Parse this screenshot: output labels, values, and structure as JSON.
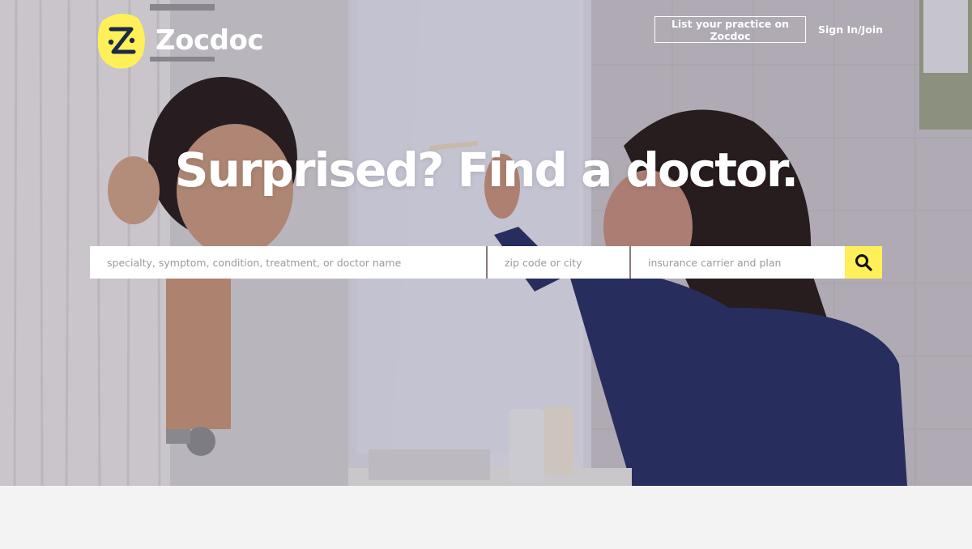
{
  "brand": {
    "name": "Zocdoc",
    "logo_color": "#fff05a",
    "logo_icon": "zocdoc-z-logo-icon"
  },
  "header": {
    "list_practice_label": "List your practice on Zocdoc",
    "sign_in_label": "Sign In/Join"
  },
  "hero": {
    "headline": "Surprised? Find a doctor."
  },
  "search": {
    "specialty_placeholder": "specialty, symptom, condition, treatment, or doctor name",
    "location_placeholder": "zip code or city",
    "insurance_placeholder": "insurance carrier and plan",
    "button_icon": "search-icon",
    "button_color": "#fff05a"
  }
}
